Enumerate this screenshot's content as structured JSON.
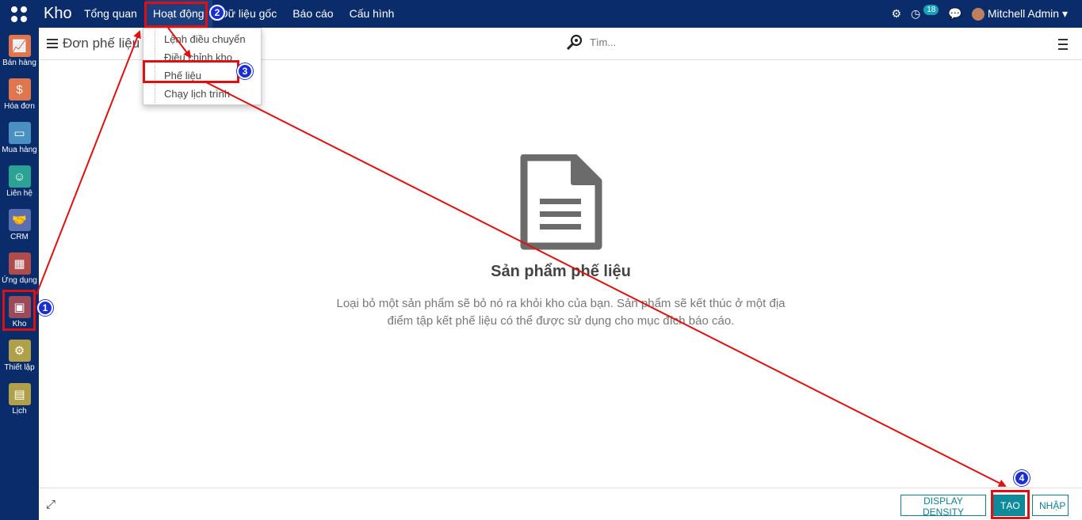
{
  "app": {
    "brand": "Kho"
  },
  "menu": [
    "Tổng quan",
    "Hoạt động",
    "Dữ liệu gốc",
    "Báo cáo",
    "Cấu hình"
  ],
  "topright": {
    "activity_count": "18",
    "user": "Mitchell Admin"
  },
  "sidebar": [
    {
      "label": "Bán hàng",
      "icon": "sales-chart-icon",
      "color": "#e0764d"
    },
    {
      "label": "Hóa đơn",
      "icon": "invoice-icon",
      "color": "#e0764d"
    },
    {
      "label": "Mua hàng",
      "icon": "purchase-card-icon",
      "color": "#4a90c0"
    },
    {
      "label": "Liên hệ",
      "icon": "contacts-icon",
      "color": "#2aa394"
    },
    {
      "label": "CRM",
      "icon": "handshake-icon",
      "color": "#5a6fb0"
    },
    {
      "label": "Ứng dụng",
      "icon": "apps-cubes-icon",
      "color": "#b04b4b"
    },
    {
      "label": "Kho",
      "icon": "warehouse-box-icon",
      "color": "#9b4a5a"
    },
    {
      "label": "Thiết lập",
      "icon": "settings-gear-icon",
      "color": "#b0a04a"
    },
    {
      "label": "Lịch",
      "icon": "calendar-icon",
      "color": "#b0a04a"
    }
  ],
  "control": {
    "breadcrumb": "Đơn phế liệu",
    "search_placeholder": "Tìm..."
  },
  "dropdown": [
    "Lệnh điều chuyển",
    "Điều chỉnh kho",
    "Phế liệu",
    "Chạy lịch trình"
  ],
  "empty": {
    "title": "Sản phẩm phế liệu",
    "line1": "Loại bỏ một sản phẩm sẽ bỏ nó ra khỏi kho của bạn. Sản phẩm sẽ kết thúc ở một địa",
    "line2": "điểm tập kết phế liệu có thể được sử dụng cho mục đích báo cáo."
  },
  "footer": {
    "density": "DISPLAY DENSITY",
    "create": "TẠO",
    "import": "NHẬP"
  },
  "annotations": [
    "1",
    "2",
    "3",
    "4"
  ]
}
